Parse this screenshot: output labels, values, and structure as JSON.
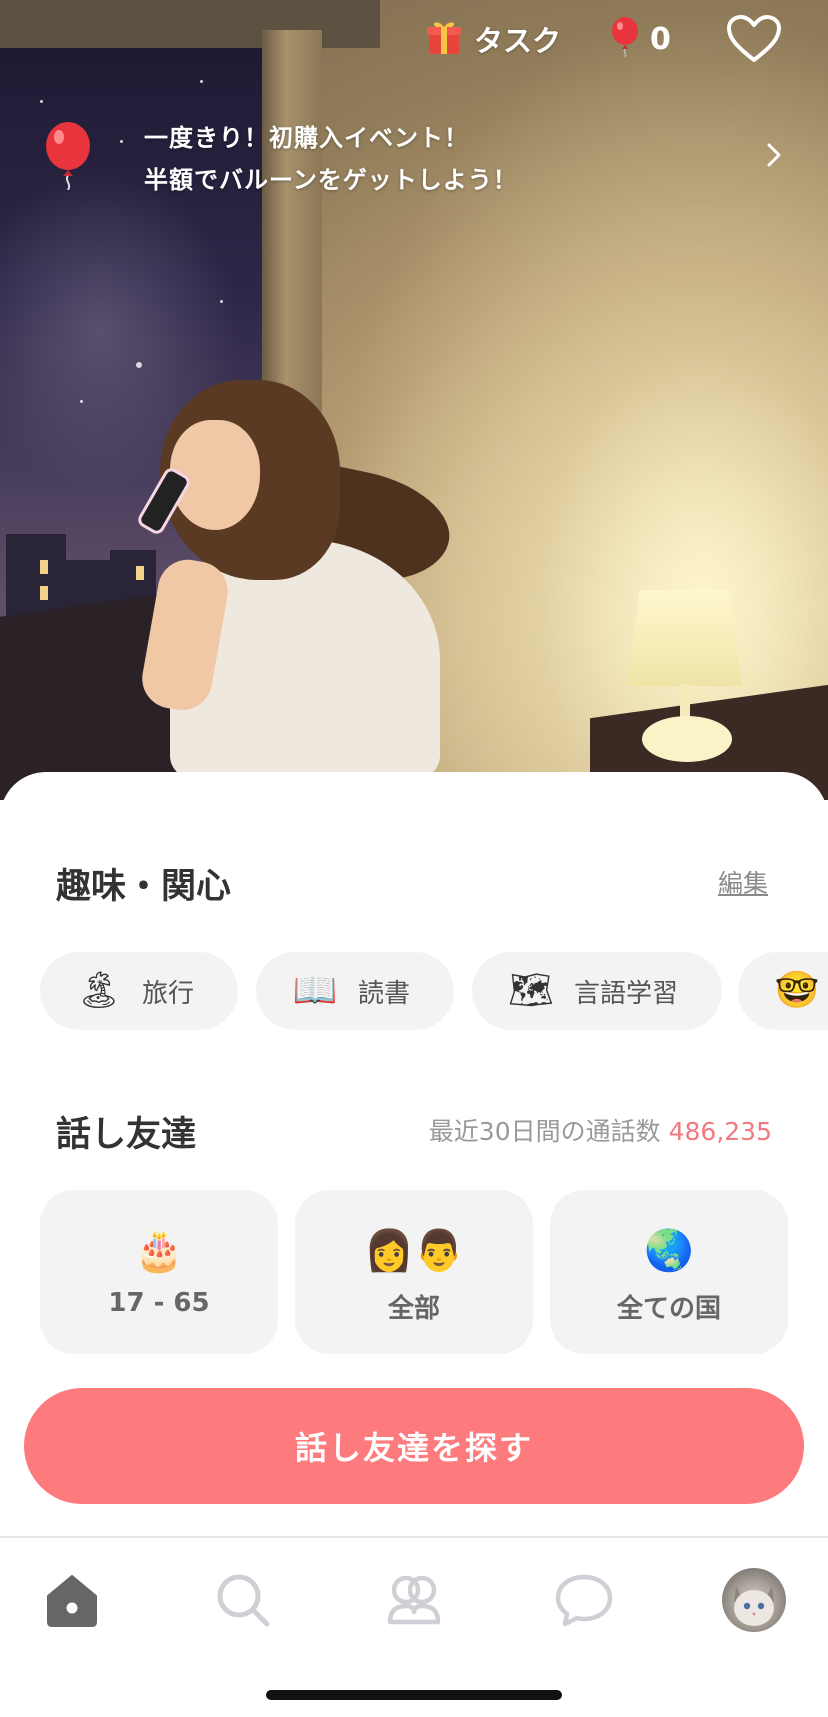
{
  "header": {
    "task_label": "タスク",
    "balloon_count": "0"
  },
  "promo": {
    "line1": "一度きり！初購入イベント！",
    "line2": "半額でバルーンをゲットしよう！"
  },
  "interests": {
    "title": "趣味・関心",
    "edit_label": "編集",
    "chips": [
      {
        "emoji": "🏝",
        "label": "旅行"
      },
      {
        "emoji": "📖",
        "label": "読書"
      },
      {
        "emoji": "🗺",
        "label": "言語学習"
      },
      {
        "emoji": "🤓",
        "label": ""
      }
    ]
  },
  "friends": {
    "title": "話し友達",
    "calls_label": "最近30日間の通話数",
    "calls_value": "486,235",
    "filters": [
      {
        "icon": "🎂",
        "label": "17 - 65"
      },
      {
        "icon": "👩👨",
        "label": "全部"
      },
      {
        "icon": "🌏",
        "label": "全ての国"
      }
    ],
    "find_button": "話し友達を探す"
  },
  "colors": {
    "accent": "#fd7a7d",
    "accent_text": "#f07a80",
    "chip_bg": "#f3f3f3"
  },
  "nav": {
    "items": [
      "home-icon",
      "search-icon",
      "people-icon",
      "chat-icon",
      "avatar"
    ],
    "active": "home-icon"
  }
}
